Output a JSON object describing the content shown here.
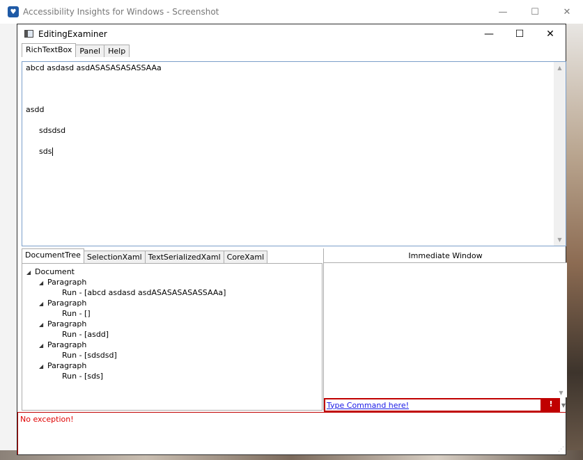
{
  "outer_window": {
    "title": "Accessibility Insights for Windows - Screenshot",
    "minimize": "—",
    "maximize": "☐",
    "close": "✕"
  },
  "inner_window": {
    "title": "EditingExaminer",
    "minimize": "—",
    "maximize": "☐",
    "close": "✕"
  },
  "top_tabs": [
    "RichTextBox",
    "Panel",
    "Help"
  ],
  "richtext": {
    "lines": [
      "abcd asdasd asdASASASASASSAAa",
      "asdd",
      "sdsdsd",
      "sds"
    ]
  },
  "lower_tabs": [
    "DocumentTree",
    "SelectionXaml",
    "TextSerializedXaml",
    "CoreXaml"
  ],
  "tree": {
    "root": "Document",
    "paragraph_label": "Paragraph",
    "runs": [
      "Run - [abcd asdasd asdASASASASASSAAa]",
      "Run - []",
      "Run - [asdd]",
      "Run - [sdsdsd]",
      "Run - [sds]"
    ]
  },
  "immediate": {
    "header": "Immediate Window",
    "command_placeholder": "Type Command here!",
    "alert_glyph": "!"
  },
  "exception": {
    "text": "No exception!"
  },
  "colors": {
    "accent_error": "#c00000",
    "link_blue": "#1a1ae6",
    "richtext_border": "#7a9ec9"
  }
}
